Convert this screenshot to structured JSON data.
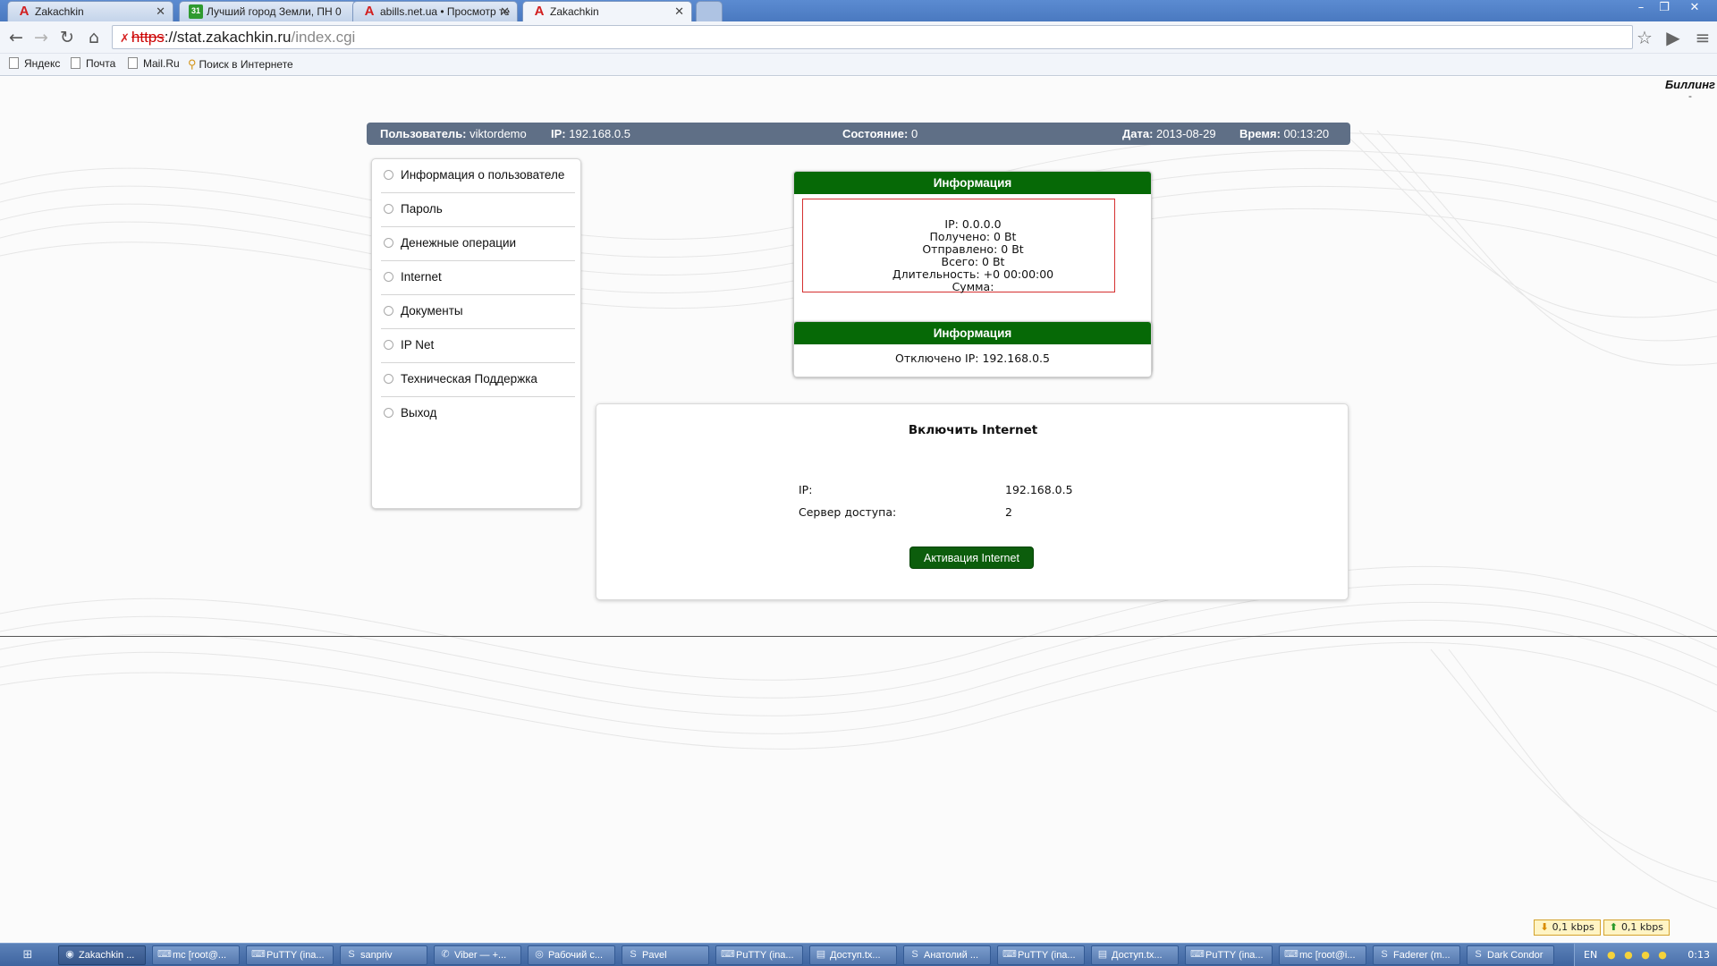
{
  "browser": {
    "tabs": [
      {
        "title": "Zakachkin",
        "icon": "abills-logo-icon"
      },
      {
        "title": "Лучший город Земли, ПН 0",
        "icon": "calendar-icon"
      },
      {
        "title": "abills.net.ua • Просмотр те",
        "icon": "abills-logo-icon"
      },
      {
        "title": "Zakachkin",
        "icon": "abills-logo-icon",
        "active": true
      }
    ],
    "url": {
      "scheme": "https",
      "host": "://stat.zakachkin.ru",
      "path": "/index.cgi"
    },
    "bookmarks": [
      "Яндекс",
      "Почта",
      "Mail.Ru",
      "Поиск в Интернете"
    ]
  },
  "page": {
    "corner_title": "Биллинг",
    "corner_sub": "-",
    "status": {
      "user_label": "Пользователь:",
      "user": "viktordemo",
      "ip_label": "IP:",
      "ip": "192.168.0.5",
      "state_label": "Состояние:",
      "state": "0",
      "date_label": "Дата:",
      "date": "2013-08-29",
      "time_label": "Время:",
      "time": "00:13:20"
    },
    "menu": [
      "Информация о пользователе",
      "Пароль",
      "Денежные операции",
      "Internet",
      "Документы",
      "IP Net",
      "Техническая Поддержка",
      "Выход"
    ],
    "info1": {
      "title": "Информация",
      "lines": [
        "IP: 0.0.0.0",
        "Получено: 0 Bt",
        "Отправлено: 0 Bt",
        "Всего: 0 Bt",
        "Длительность: +0 00:00:00",
        "Сумма:"
      ]
    },
    "info2": {
      "title": "Информация",
      "text": "Отключено IP: 192.168.0.5"
    },
    "enable": {
      "title": "Включить Internet",
      "ip_label": "IP:",
      "ip": "192.168.0.5",
      "server_label": "Сервер доступа:",
      "server": "2",
      "button": "Активация Internet"
    },
    "speed": {
      "down": "0,1 kbps",
      "up": "0,1 kbps"
    }
  },
  "taskbar": {
    "items": [
      {
        "label": "Zakachkin ...",
        "icon": "chrome-icon",
        "active": true
      },
      {
        "label": "mc [root@...",
        "icon": "putty-icon"
      },
      {
        "label": "PuTTY (ina...",
        "icon": "putty-icon"
      },
      {
        "label": "sanpriv",
        "icon": "skype-icon"
      },
      {
        "label": "Viber — +...",
        "icon": "viber-icon"
      },
      {
        "label": "Рабочий с...",
        "icon": "app-icon"
      },
      {
        "label": "Pavel",
        "icon": "skype-icon"
      },
      {
        "label": "PuTTY (ina...",
        "icon": "putty-icon"
      },
      {
        "label": "Доступ.tx...",
        "icon": "notepad-icon"
      },
      {
        "label": "Анатолий ...",
        "icon": "skype-icon"
      },
      {
        "label": "PuTTY (ina...",
        "icon": "putty-icon"
      },
      {
        "label": "Доступ.tx...",
        "icon": "notepad-icon"
      },
      {
        "label": "PuTTY (ina...",
        "icon": "putty-icon"
      },
      {
        "label": "mc [root@i...",
        "icon": "putty-icon"
      },
      {
        "label": "Faderer (m...",
        "icon": "skype-icon"
      },
      {
        "label": "Dark Condor",
        "icon": "skype-icon"
      }
    ],
    "lang": "EN",
    "clock": "0:13"
  }
}
